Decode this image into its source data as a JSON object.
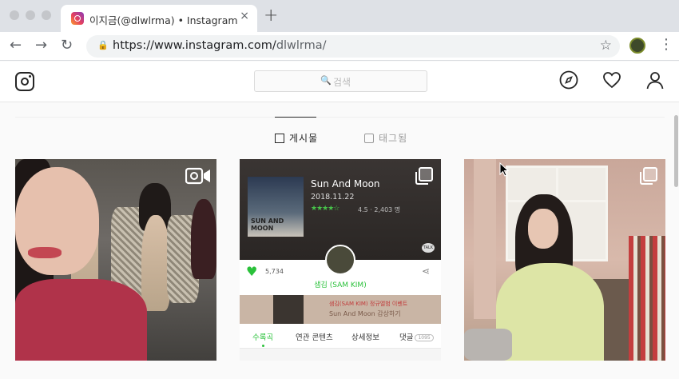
{
  "browser": {
    "tab_title": "이지금(@dlwlrma) • Instagram 사진 및 동영상",
    "tab_close": "×",
    "new_tab": "+",
    "url_host": "https://www.instagram.com/",
    "url_path": "dlwlrma/"
  },
  "instagram": {
    "search_placeholder": "검색",
    "profile_tabs": [
      {
        "label": "게시물",
        "icon": "grid-icon",
        "active": true
      },
      {
        "label": "태그됨",
        "icon": "tag-person-icon",
        "active": false
      }
    ],
    "posts": [
      {
        "type": "video",
        "icon": "video-camera-icon"
      },
      {
        "type": "carousel",
        "icon": "multiple-images-icon",
        "music": {
          "album_text": "SUN AND MOON",
          "song_title": "Sun And Moon",
          "release_date": "2018.11.22",
          "stars": "★★★★☆",
          "rating": "4.5 · 2,403 명",
          "talk_label": "TALK",
          "like_count": "5,734",
          "artist": "샘김 (SAM KIM)",
          "banner_line1": "샘김(SAM KIM) 정규앨범 이벤트",
          "banner_line2": "Sun And Moon 감상하기",
          "tabs": [
            "수록곡",
            "연관 콘텐츠",
            "상세정보",
            "댓글"
          ],
          "comment_badge": "1095"
        }
      },
      {
        "type": "carousel",
        "icon": "multiple-images-icon"
      }
    ]
  },
  "colors": {
    "music_accent": "#2ac13a",
    "text_dark": "#262626"
  }
}
